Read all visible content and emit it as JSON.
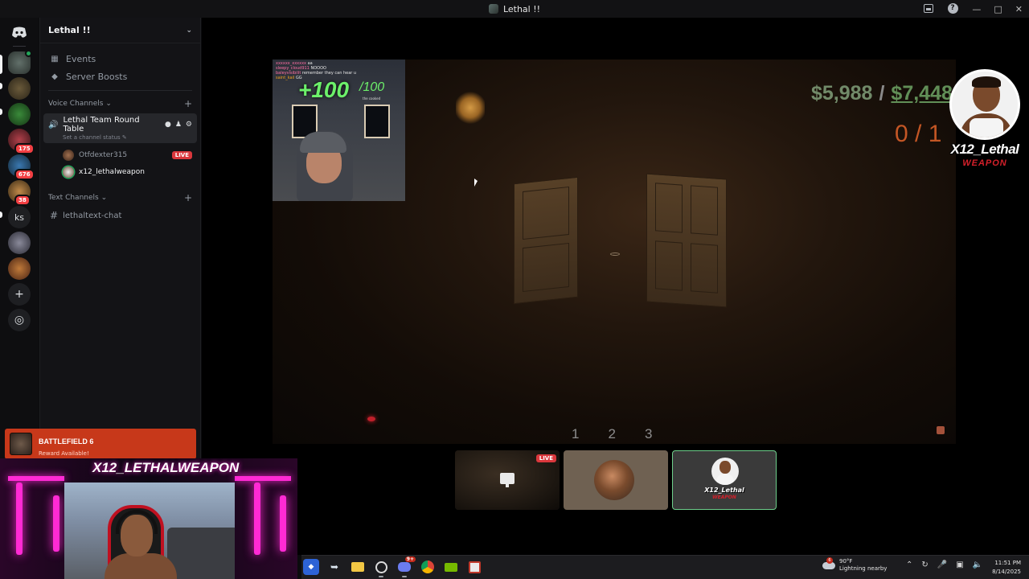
{
  "window": {
    "title": "Lethal !!"
  },
  "rail": {
    "badges": [
      "175",
      "676",
      "38"
    ],
    "ks_label": "ks"
  },
  "sidebar": {
    "server_name": "Lethal !!",
    "menu": [
      {
        "label": "Events",
        "icon": "calendar-icon"
      },
      {
        "label": "Server Boosts",
        "icon": "boost-icon"
      }
    ],
    "voice_category": "Voice Channels",
    "voice_channel": {
      "name": "Lethal Team Round Table",
      "status": "Set a channel status"
    },
    "members": [
      {
        "name": "Otfdexter315",
        "live": "LIVE"
      },
      {
        "name": "x12_lethalweapon"
      }
    ],
    "text_category": "Text Channels",
    "text_channel": "lethaltext-chat"
  },
  "stream": {
    "hud": {
      "money_current": "$5,988",
      "money_goal": "$7,448",
      "quota": "0 / 1",
      "slots": [
        "1",
        "2",
        "3"
      ]
    },
    "cam_overlay": {
      "plus_value": "+100",
      "max_value": "/100",
      "sub_text": "the cooked",
      "chat": [
        {
          "user": "xxxxxx_xxxxxx",
          "msg": "aa"
        },
        {
          "user": "sleepy_cloud911",
          "msg": "NOOOO"
        },
        {
          "user": "baleyvisibilit",
          "msg": "remember they can hear u"
        },
        {
          "user": "saint_kail",
          "msg": "GG"
        }
      ]
    },
    "overlay_logo": {
      "name": "X12_Lethal",
      "sub": "WEAPON"
    },
    "tiles": [
      {
        "label": "LIVE"
      },
      {},
      {
        "name": "X12_Lethal",
        "sub": "WEAPON"
      }
    ]
  },
  "streamer_overlay": {
    "reward_game": "BATTLEFIELD 6",
    "reward_text": "Reward Available!",
    "name": "X12_LETHALWEAPON"
  },
  "taskbar": {
    "discord_badge": "9+",
    "weather_badge": "6",
    "temp": "90°F",
    "weather_desc": "Lightning nearby",
    "time": "11:51 PM",
    "date": "8/14/2025"
  },
  "colors": {
    "accent_green": "#23a55a",
    "live_red": "#da373c",
    "neon_pink": "#ff2ad4"
  }
}
